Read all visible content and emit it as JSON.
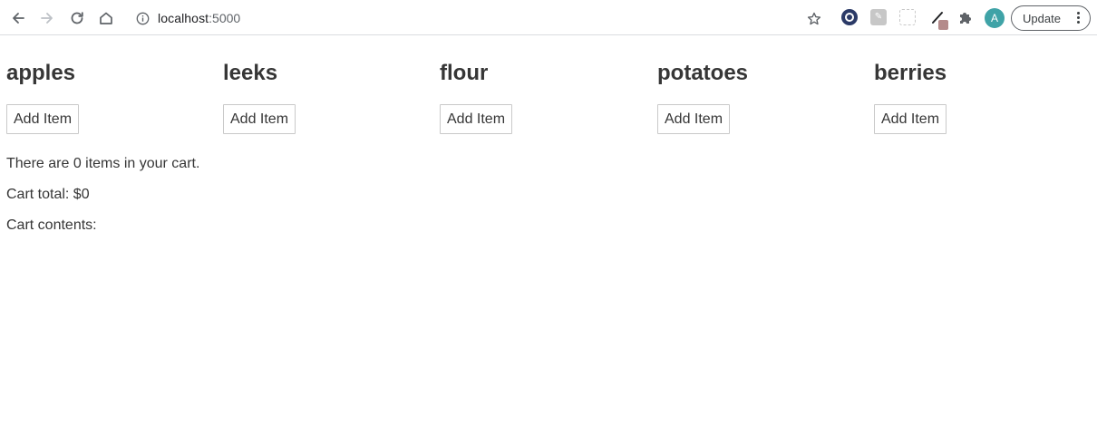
{
  "browser": {
    "url_host": "localhost",
    "url_port": ":5000",
    "avatar_letter": "A",
    "update_label": "Update",
    "icons": {
      "back": "back-arrow-icon",
      "forward": "forward-arrow-icon",
      "reload": "reload-icon",
      "home": "home-icon",
      "info": "info-icon",
      "bookmark": "star-icon",
      "extensions": "puzzle-icon"
    }
  },
  "products": [
    {
      "name": "apples",
      "button_label": "Add Item"
    },
    {
      "name": "leeks",
      "button_label": "Add Item"
    },
    {
      "name": "flour",
      "button_label": "Add Item"
    },
    {
      "name": "potatoes",
      "button_label": "Add Item"
    },
    {
      "name": "berries",
      "button_label": "Add Item"
    }
  ],
  "cart": {
    "count_text": "There are 0 items in your cart.",
    "total_text": "Cart total: $0",
    "contents_text": "Cart contents:"
  },
  "colors": {
    "text": "#363636",
    "accent_avatar": "#3fa3a7",
    "border": "#c9c9c9"
  }
}
